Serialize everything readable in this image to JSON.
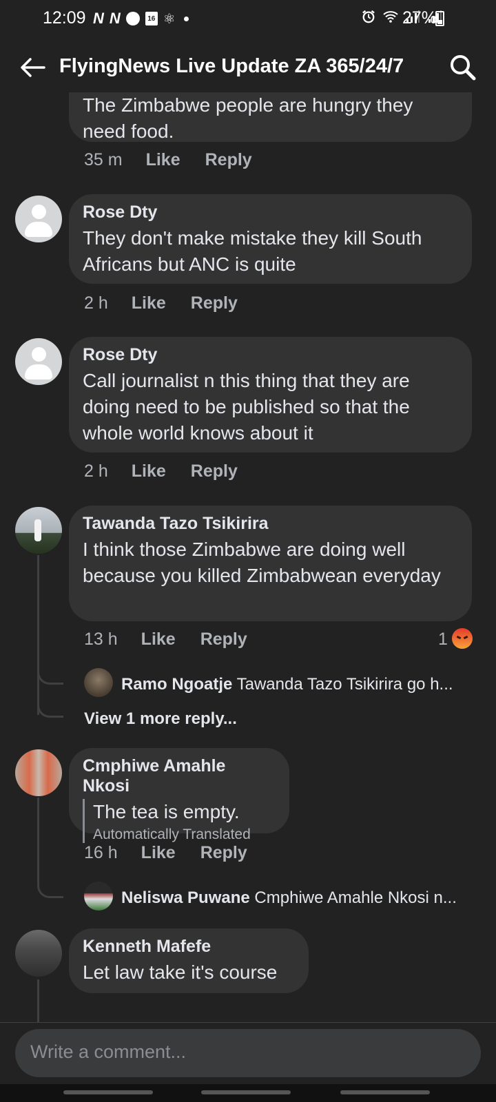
{
  "status_bar": {
    "time": "12:09",
    "left_icons": [
      "n-icon",
      "n-icon",
      "messenger-icon",
      "calendar-icon",
      "accessibility-icon",
      "dot-icon"
    ],
    "calendar_day": "16",
    "battery": "27%"
  },
  "header": {
    "title": "FlyingNews Live Update ZA 365/24/7"
  },
  "comments": [
    {
      "author": "",
      "text": "The Zimbabwe people are hungry they need food.",
      "time": "35 m",
      "like": "Like",
      "reply": "Reply"
    },
    {
      "author": "Rose Dty",
      "text": "They don't make mistake they kill South Africans but ANC is quite",
      "time": "2 h",
      "like": "Like",
      "reply": "Reply"
    },
    {
      "author": "Rose Dty",
      "text": "Call journalist n this thing that they are doing need to be published so that the whole world knows about it",
      "time": "2 h",
      "like": "Like",
      "reply": "Reply"
    },
    {
      "author": "Tawanda Tazo Tsikirira",
      "text": "I think those Zimbabwe are doing well because you killed Zimbabwean everyday",
      "time": "13 h",
      "like": "Like",
      "reply": "Reply",
      "reaction_count": "1",
      "reaction_icon": "angry-icon",
      "reply_preview": {
        "author": "Ramo Ngoatje",
        "text": "Tawanda Tazo Tsikirira go h..."
      },
      "view_more": "View 1 more reply..."
    },
    {
      "author": "Cmphiwe Amahle Nkosi",
      "text": "The tea is empty.",
      "translated_label": "Automatically Translated",
      "time": "16 h",
      "like": "Like",
      "reply": "Reply",
      "reply_preview": {
        "author": "Neliswa Puwane",
        "text": "Cmphiwe Amahle Nkosi n..."
      }
    },
    {
      "author": "Kenneth Mafefe",
      "text": "Let law take it's course"
    }
  ],
  "composer": {
    "placeholder": "Write a comment..."
  },
  "colors": {
    "background": "#222222",
    "bubble": "#333334",
    "secondary_text": "#b0b3b8"
  }
}
